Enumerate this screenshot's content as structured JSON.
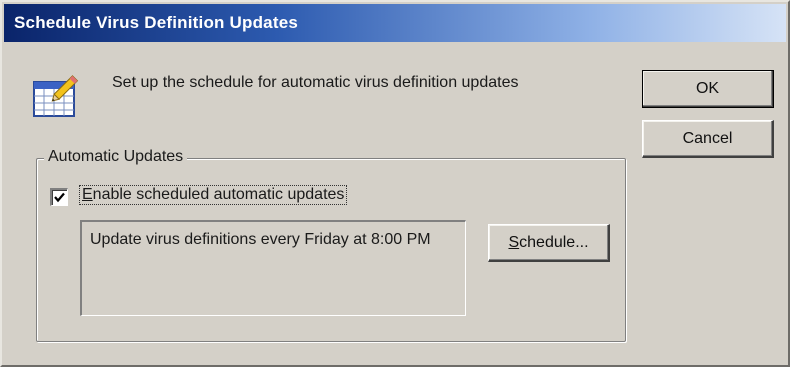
{
  "window": {
    "title": "Schedule Virus Definition Updates"
  },
  "header": {
    "icon": "calendar-pencil-icon",
    "text": "Set up the schedule for automatic virus definition updates"
  },
  "buttons": {
    "ok_label": "OK",
    "cancel_label": "Cancel"
  },
  "automatic_updates": {
    "group_label": "Automatic Updates",
    "enable_checkbox": {
      "checked": true,
      "label_mnemonic": "E",
      "label_rest": "nable scheduled automatic updates"
    },
    "schedule_description": "Update virus definitions every Friday at 8:00 PM",
    "schedule_button": {
      "label_mnemonic": "S",
      "label_rest": "chedule..."
    }
  },
  "colors": {
    "dialog_face": "#d4d0c8",
    "titlebar_start": "#0a246a",
    "titlebar_end": "#d6e3f6"
  }
}
